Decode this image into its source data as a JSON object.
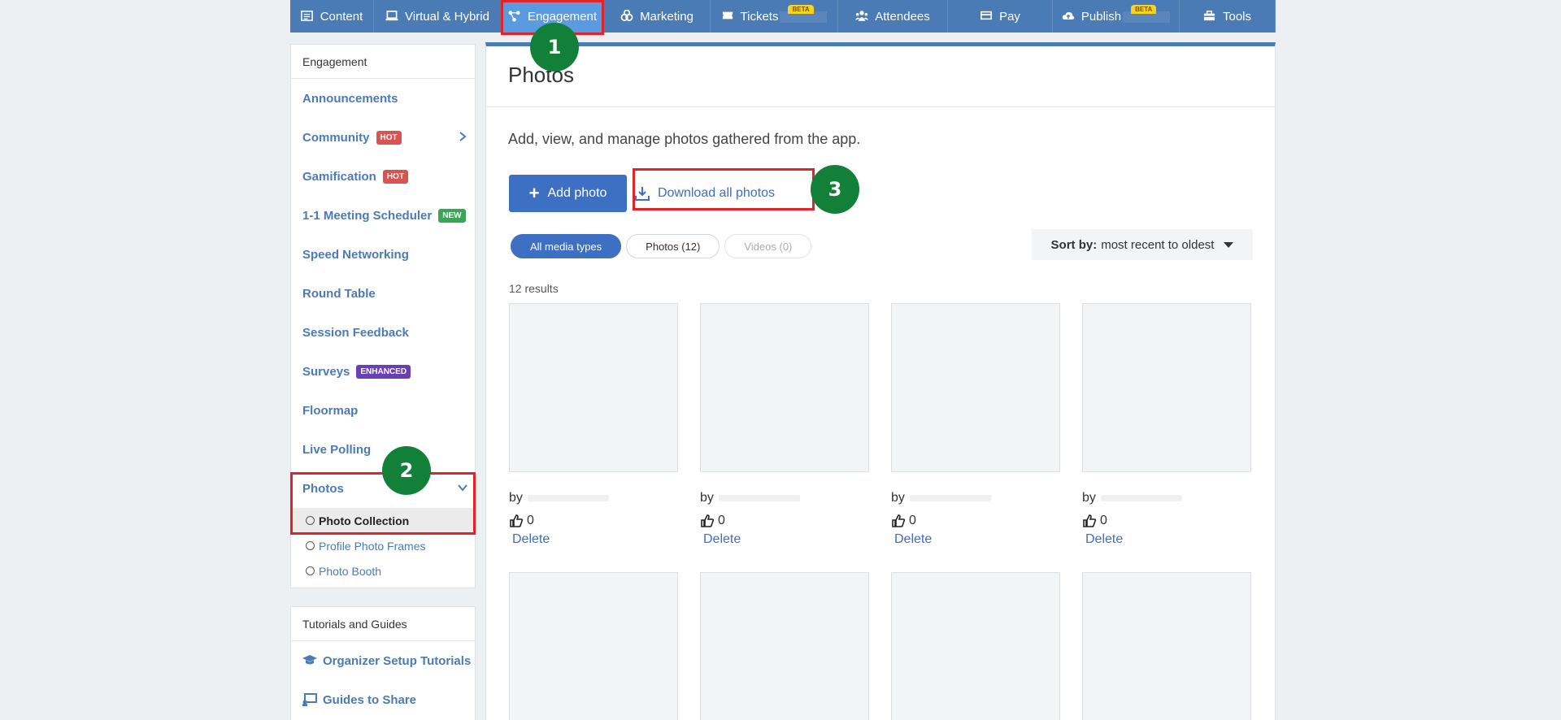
{
  "topnav": [
    {
      "label": "Content",
      "icon": "content-icon",
      "width": 103
    },
    {
      "label": "Virtual & Hybrid",
      "icon": "monitor-icon",
      "width": 157
    },
    {
      "label": "Engagement",
      "icon": "engagement-icon",
      "width": 126,
      "active": true
    },
    {
      "label": "Marketing",
      "icon": "marketing-icon",
      "width": 131
    },
    {
      "label": "Tickets",
      "icon": "ticket-icon",
      "width": 157,
      "badge": "BETA"
    },
    {
      "label": "Attendees",
      "icon": "attendees-icon",
      "width": 135
    },
    {
      "label": "Pay",
      "icon": "card-icon",
      "width": 129
    },
    {
      "label": "Publish",
      "icon": "cloud-upload-icon",
      "width": 156,
      "badge": "BETA"
    },
    {
      "label": "Tools",
      "icon": "toolbox-icon",
      "width": 118
    }
  ],
  "sidebar": {
    "title": "Engagement",
    "items": [
      {
        "label": "Announcements"
      },
      {
        "label": "Community",
        "tag": "HOT",
        "tag_type": "hot",
        "chevron": "right"
      },
      {
        "label": "Gamification",
        "tag": "HOT",
        "tag_type": "hot"
      },
      {
        "label": "1-1 Meeting Scheduler",
        "tag": "NEW",
        "tag_type": "new"
      },
      {
        "label": "Speed Networking"
      },
      {
        "label": "Round Table"
      },
      {
        "label": "Session Feedback"
      },
      {
        "label": "Surveys",
        "tag": "ENHANCED",
        "tag_type": "enh"
      },
      {
        "label": "Floormap"
      },
      {
        "label": "Live Polling"
      },
      {
        "label": "Photos",
        "chevron": "down"
      }
    ],
    "subitems": [
      {
        "label": "Photo Collection",
        "active": true
      },
      {
        "label": "Profile Photo Frames"
      },
      {
        "label": "Photo Booth"
      }
    ]
  },
  "tutorials": {
    "title": "Tutorials and Guides",
    "items": [
      {
        "label": "Organizer Setup Tutorials",
        "icon": "graduation-cap-icon"
      },
      {
        "label": "Guides to Share",
        "icon": "guide-icon"
      }
    ]
  },
  "main": {
    "title": "Photos",
    "description": "Add, view, and manage photos gathered from the app.",
    "add_label": "Add photo",
    "download_label": "Download all photos",
    "filters": [
      {
        "label": "All media types",
        "state": "active"
      },
      {
        "label": "Photos (12)",
        "state": "normal"
      },
      {
        "label": "Videos (0)",
        "state": "disabled"
      }
    ],
    "sort_label": "Sort by:",
    "sort_value": "most recent to oldest",
    "results": "12 results",
    "photos": [
      {
        "by": "by",
        "likes": "0",
        "delete": "Delete"
      },
      {
        "by": "by",
        "likes": "0",
        "delete": "Delete"
      },
      {
        "by": "by",
        "likes": "0",
        "delete": "Delete"
      },
      {
        "by": "by",
        "likes": "0",
        "delete": "Delete"
      },
      {},
      {},
      {},
      {}
    ]
  },
  "annotations": [
    "1",
    "2",
    "3"
  ],
  "colors": {
    "accent": "#3d6fc2",
    "nav": "#4a7bb5",
    "highlight": "#e0242a",
    "step": "#13803a"
  }
}
